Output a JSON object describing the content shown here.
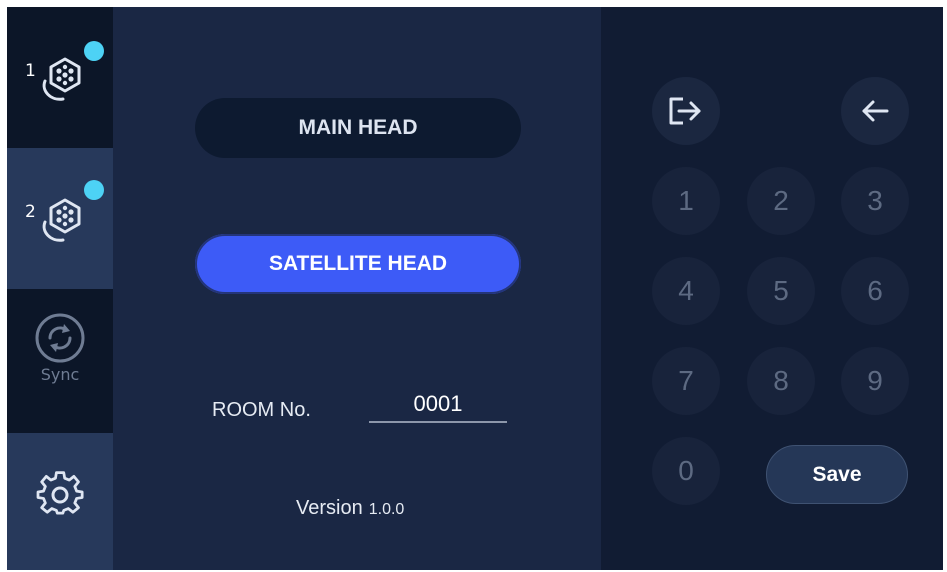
{
  "sidebar": {
    "items": [
      {
        "id": "head-1",
        "number": "1",
        "icon": "hex-node-icon",
        "status_dot": true
      },
      {
        "id": "head-2",
        "number": "2",
        "icon": "hex-node-icon",
        "status_dot": true,
        "active": true
      },
      {
        "id": "sync",
        "label": "Sync",
        "icon": "sync-icon"
      },
      {
        "id": "settings",
        "icon": "gear-icon"
      }
    ]
  },
  "main": {
    "main_head_label": "MAIN HEAD",
    "satellite_head_label": "SATELLITE HEAD",
    "room_label": "ROOM No.",
    "room_value": "0001",
    "version_label": "Version",
    "version_value": "1.0.0"
  },
  "keypad": {
    "keys": [
      "1",
      "2",
      "3",
      "4",
      "5",
      "6",
      "7",
      "8",
      "9",
      "0"
    ],
    "save_label": "Save",
    "exit_icon": "exit-icon",
    "backspace_icon": "back-arrow-icon"
  },
  "colors": {
    "accent": "#3d5bf7",
    "status_dot": "#4dd2f5",
    "background": "#1a2744",
    "sidebar": "#0c1628",
    "keypad_bg": "#111c33"
  }
}
